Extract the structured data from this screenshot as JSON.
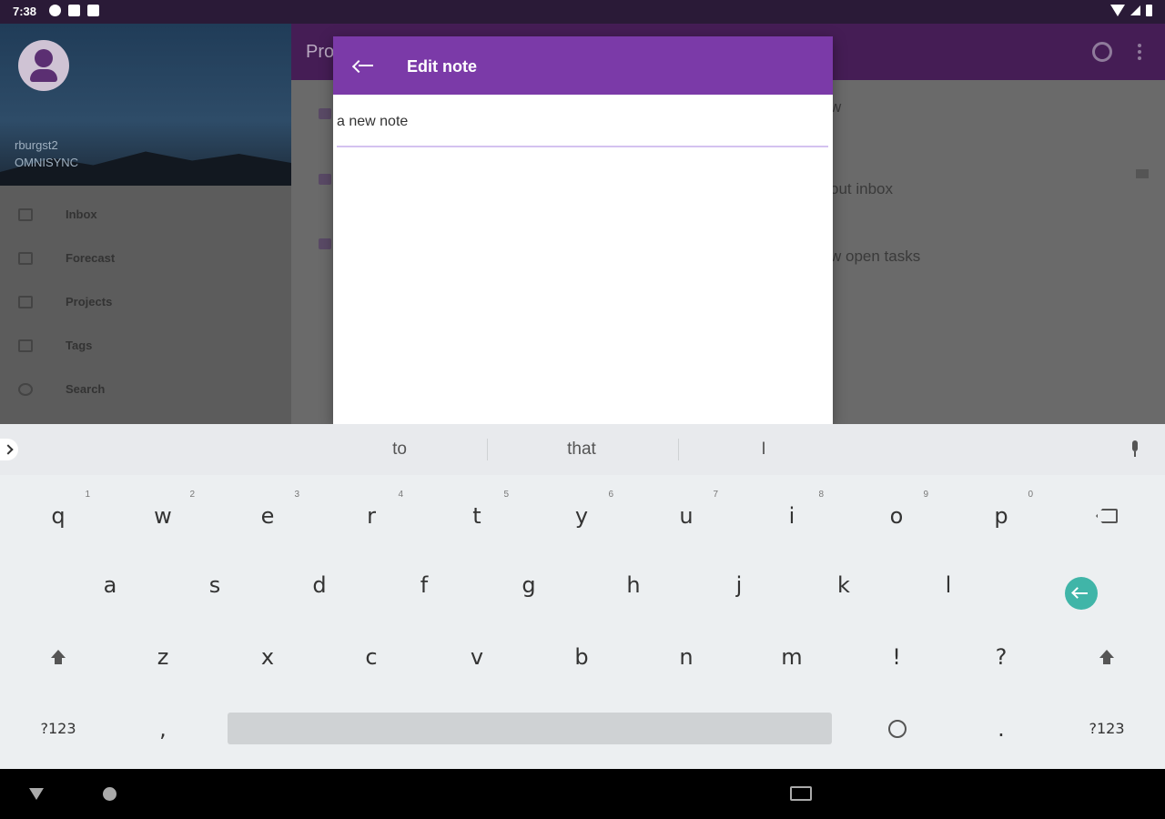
{
  "status_bar": {
    "time": "7:38"
  },
  "background_app": {
    "title": "Pro",
    "rows": [
      {
        "title": "w",
        "subtitle": ""
      },
      {
        "title": "out inbox",
        "subtitle": ""
      },
      {
        "title": "w open tasks",
        "subtitle": ""
      }
    ]
  },
  "drawer": {
    "account_name": "rburgst2",
    "account_server": "OMNISYNC",
    "items": [
      {
        "label": "Inbox",
        "icon": "inbox-icon"
      },
      {
        "label": "Forecast",
        "icon": "calendar-icon"
      },
      {
        "label": "Projects",
        "icon": "projects-icon"
      },
      {
        "label": "Tags",
        "icon": "tag-icon"
      },
      {
        "label": "Search",
        "icon": "search-icon"
      }
    ]
  },
  "dialog": {
    "title": "Edit note",
    "note_value": "a new note",
    "accent_color": "#7b3aa8"
  },
  "keyboard": {
    "suggestions": [
      "to",
      "that",
      "I"
    ],
    "row1": [
      {
        "ch": "q",
        "hint": "1"
      },
      {
        "ch": "w",
        "hint": "2"
      },
      {
        "ch": "e",
        "hint": "3"
      },
      {
        "ch": "r",
        "hint": "4"
      },
      {
        "ch": "t",
        "hint": "5"
      },
      {
        "ch": "y",
        "hint": "6"
      },
      {
        "ch": "u",
        "hint": "7"
      },
      {
        "ch": "i",
        "hint": "8"
      },
      {
        "ch": "o",
        "hint": "9"
      },
      {
        "ch": "p",
        "hint": "0"
      }
    ],
    "row2": [
      "a",
      "s",
      "d",
      "f",
      "g",
      "h",
      "j",
      "k",
      "l"
    ],
    "row3": [
      "z",
      "x",
      "c",
      "v",
      "b",
      "n",
      "m",
      "!",
      "?"
    ],
    "symbols_label": "?123",
    "comma": ",",
    "period": ".",
    "enter_color": "#40b5a8"
  }
}
